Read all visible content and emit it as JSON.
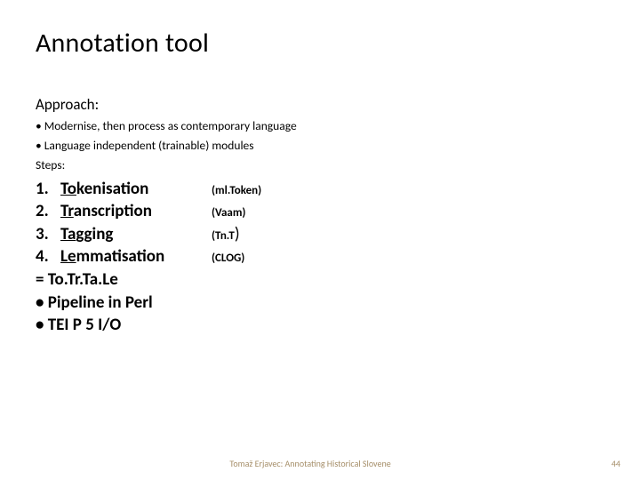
{
  "title": "Annotation tool",
  "approach_label": "Approach:",
  "approach_bullets": [
    "Modernise, then process as contemporary language",
    "Language independent (trainable) modules"
  ],
  "steps_label": "Steps:",
  "steps": [
    {
      "num": "1.",
      "ul": "To",
      "rest": "kenisation",
      "paren": "(ml.Token)"
    },
    {
      "num": "2.",
      "ul": "Tr",
      "rest": "anscription",
      "paren": "(Vaam)"
    },
    {
      "num": "3.",
      "ul": "Ta",
      "rest": "gging",
      "paren": "(Tn.T",
      "paren_tail": ")"
    },
    {
      "num": "4.",
      "ul": "Le",
      "rest": "mmatisation",
      "paren": "(CLOG)"
    }
  ],
  "tail_lines": [
    "= To.Tr.Ta.Le",
    "• Pipeline in Perl",
    "• TEI P 5 I/O"
  ],
  "footer": "Tomaž Erjavec: Annotating Historical Slovene",
  "page_number": "44"
}
